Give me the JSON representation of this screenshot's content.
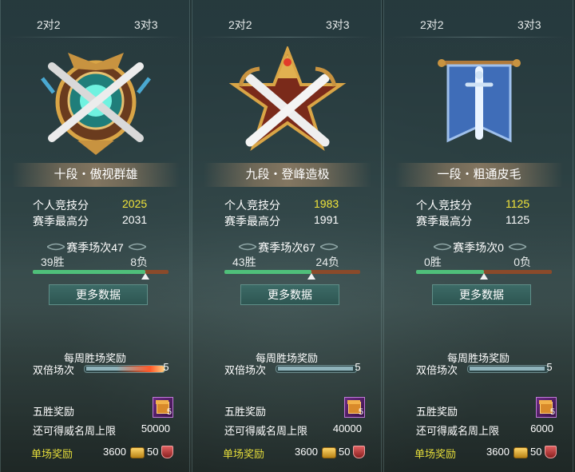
{
  "panels": [
    {
      "tabs": [
        "2对2",
        "3对3"
      ],
      "rank": "十段・傲视群雄",
      "emblem": "crossed-swords-shield-emblem-gold-cyan",
      "stats": {
        "personal_label": "个人竞技分",
        "personal_value": "2025",
        "season_high_label": "赛季最高分",
        "season_high_value": "2031"
      },
      "season": {
        "label": "赛季场次47",
        "wins": "39胜",
        "losses": "8负",
        "win_fraction": 0.83
      },
      "more_button": "更多数据",
      "weekly": {
        "title": "每周胜场奖励",
        "double_label": "双倍场次",
        "double_count": "5",
        "progress": 1.0
      },
      "five_win": {
        "label": "五胜奖励",
        "count": "5"
      },
      "cap": {
        "label": "还可得威名周上限",
        "value": "50000"
      },
      "single": {
        "label": "单场奖励",
        "coins": "3600",
        "honor": "50"
      }
    },
    {
      "tabs": [
        "2对2",
        "3对3"
      ],
      "rank": "九段・登峰造极",
      "emblem": "crossed-swords-star-emblem-gold-red",
      "stats": {
        "personal_label": "个人竞技分",
        "personal_value": "1983",
        "season_high_label": "赛季最高分",
        "season_high_value": "1991"
      },
      "season": {
        "label": "赛季场次67",
        "wins": "43胜",
        "losses": "24负",
        "win_fraction": 0.64
      },
      "more_button": "更多数据",
      "weekly": {
        "title": "每周胜场奖励",
        "double_label": "双倍场次",
        "double_count": "5",
        "progress": 0.0
      },
      "five_win": {
        "label": "五胜奖励",
        "count": "5"
      },
      "cap": {
        "label": "还可得威名周上限",
        "value": "40000"
      },
      "single": {
        "label": "单场奖励",
        "coins": "3600",
        "honor": "50"
      }
    },
    {
      "tabs": [
        "2对2",
        "3对3"
      ],
      "rank": "一段・粗通皮毛",
      "emblem": "sword-banner-emblem-blue",
      "stats": {
        "personal_label": "个人竞技分",
        "personal_value": "1125",
        "season_high_label": "赛季最高分",
        "season_high_value": "1125"
      },
      "season": {
        "label": "赛季场次0",
        "wins": "0胜",
        "losses": "0负",
        "win_fraction": 0.5
      },
      "more_button": "更多数据",
      "weekly": {
        "title": "每周胜场奖励",
        "double_label": "双倍场次",
        "double_count": "5",
        "progress": 0.0
      },
      "five_win": {
        "label": "五胜奖励",
        "count": "5"
      },
      "cap": {
        "label": "还可得威名周上限",
        "value": "6000"
      },
      "single": {
        "label": "单场奖励",
        "coins": "3600",
        "honor": "50"
      }
    }
  ],
  "colors": {
    "highlight": "#f2e53a",
    "win_bar": "#4fbf7a",
    "loss_bar": "#8a4a2a",
    "single_reward": "#e6de3a"
  }
}
